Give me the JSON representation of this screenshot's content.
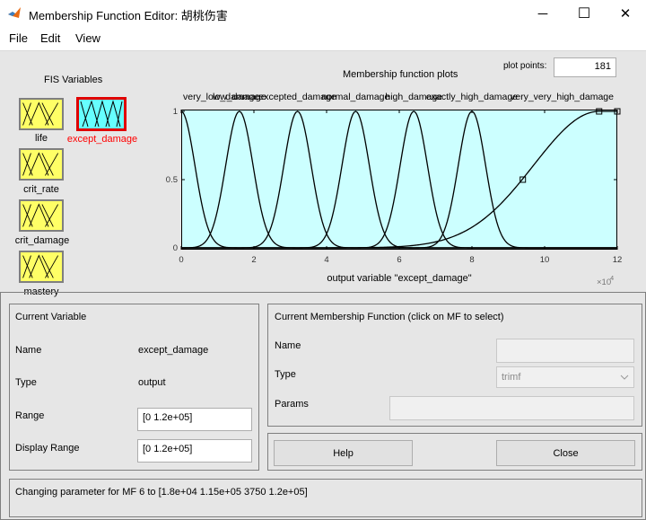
{
  "window": {
    "title": "Membership Function Editor: 胡桃伤害",
    "minimize": "─",
    "maximize": "☐",
    "close": "✕"
  },
  "menu": {
    "file": "File",
    "edit": "Edit",
    "view": "View"
  },
  "fis": {
    "title": "FIS Variables",
    "inputs": [
      {
        "label": "life"
      },
      {
        "label": "crit_rate"
      },
      {
        "label": "crit_damage"
      },
      {
        "label": "mastery"
      }
    ],
    "output": {
      "label": "except_damage"
    }
  },
  "plot": {
    "title": "Membership function plots",
    "points_label": "plot points:",
    "points_value": "181",
    "xlabel": "output variable \"except_damage\"",
    "exponent": "×10",
    "exponent_power": "4",
    "xticks": [
      "0",
      "2",
      "4",
      "6",
      "8",
      "10",
      "12"
    ],
    "yticks": [
      "0",
      "0.5",
      "1"
    ],
    "mf_labels": [
      "very_low_damage",
      "low_damage",
      "excepted_damage",
      "normal_damage",
      "high_damage",
      "exactly_high_damage",
      "very_very_high_damage"
    ],
    "colors": {
      "background": "#ccffff",
      "curves": "#000000"
    }
  },
  "chart_data": {
    "type": "line",
    "xlim": [
      0,
      120000
    ],
    "ylim": [
      0,
      1
    ],
    "x_axis_multiplier": "×10^4",
    "series": [
      {
        "name": "very_low_damage",
        "mf": "gaussmf",
        "sigma": 3750,
        "center": 0
      },
      {
        "name": "low_damage",
        "mf": "gaussmf",
        "sigma": 3750,
        "center": 16000
      },
      {
        "name": "excepted_damage",
        "mf": "gaussmf",
        "sigma": 3750,
        "center": 32000
      },
      {
        "name": "normal_damage",
        "mf": "gaussmf",
        "sigma": 3750,
        "center": 48000
      },
      {
        "name": "high_damage",
        "mf": "gaussmf",
        "sigma": 3750,
        "center": 64000
      },
      {
        "name": "exactly_high_damage",
        "mf": "gaussmf",
        "sigma": 3750,
        "center": 80000
      },
      {
        "name": "very_very_high_damage",
        "mf": "gauss2mf",
        "params": [
          18000,
          115000,
          3750,
          120000
        ],
        "selected": true
      }
    ],
    "selected_points": [
      [
        94000,
        0.5
      ],
      [
        115000,
        1
      ],
      [
        120000,
        1
      ]
    ]
  },
  "current_variable": {
    "heading": "Current Variable",
    "name_label": "Name",
    "name_value": "except_damage",
    "type_label": "Type",
    "type_value": "output",
    "range_label": "Range",
    "range_value": "[0 1.2e+05]",
    "display_range_label": "Display Range",
    "display_range_value": "[0 1.2e+05]"
  },
  "current_mf": {
    "heading": "Current Membership Function (click on MF to select)",
    "name_label": "Name",
    "name_value": "",
    "type_label": "Type",
    "type_value": "trimf",
    "params_label": "Params",
    "params_value": ""
  },
  "buttons": {
    "help": "Help",
    "close": "Close"
  },
  "status": "Changing parameter for MF 6 to  [1.8e+04 1.15e+05 3750 1.2e+05]"
}
